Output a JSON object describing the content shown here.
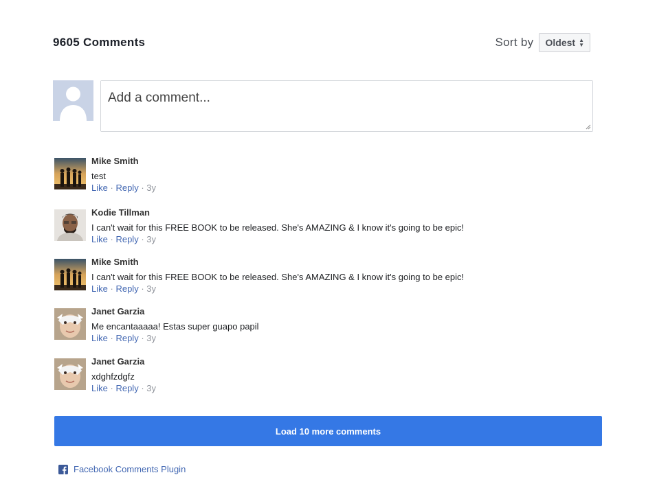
{
  "header": {
    "count_label": "9605 Comments",
    "sort_label": "Sort by",
    "sort_selected": "Oldest"
  },
  "composer": {
    "placeholder": "Add a comment..."
  },
  "comments": [
    {
      "author": "Mike Smith",
      "text": "test",
      "like": "Like",
      "reply": "Reply",
      "age": "3y",
      "avatar": "sunset-group-photo"
    },
    {
      "author": "Kodie Tillman",
      "text": "I can't wait for this FREE BOOK to be released. She's AMAZING & I know it's going to be epic!",
      "like": "Like",
      "reply": "Reply",
      "age": "3y",
      "avatar": "man-portrait-photo"
    },
    {
      "author": "Mike Smith",
      "text": "I can't wait for this FREE BOOK to be released. She's AMAZING & I know it's going to be epic!",
      "like": "Like",
      "reply": "Reply",
      "age": "3y",
      "avatar": "sunset-group-photo"
    },
    {
      "author": "Janet Garzia",
      "text": "Me encantaaaaa! Estas super guapo papil",
      "like": "Like",
      "reply": "Reply",
      "age": "3y",
      "avatar": "child-mask-photo"
    },
    {
      "author": "Janet Garzia",
      "text": "xdghfzdgfz",
      "like": "Like",
      "reply": "Reply",
      "age": "3y",
      "avatar": "child-mask-photo"
    }
  ],
  "separator": "·",
  "load_more_label": "Load 10 more comments",
  "plugin_label": "Facebook Comments Plugin",
  "colors": {
    "accent": "#3578e5",
    "link": "#4267b2",
    "facebook": "#3b5998"
  }
}
